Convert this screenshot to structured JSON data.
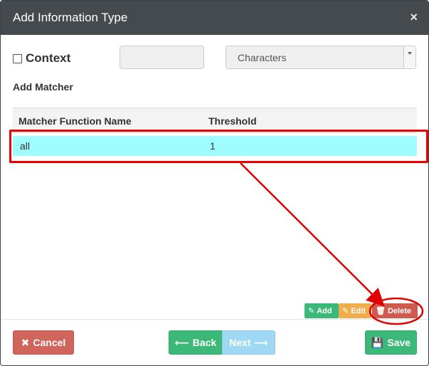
{
  "dialog": {
    "title": "Add Information Type",
    "close_glyph": "×"
  },
  "form": {
    "context_label": "Context",
    "context_input_value": "",
    "select_value": "Characters",
    "section_label": "Add Matcher"
  },
  "table": {
    "columns": [
      "Matcher Function Name",
      "Threshold"
    ],
    "rows": [
      {
        "name": "all",
        "threshold": "1"
      }
    ]
  },
  "row_actions": {
    "add_label": "Add",
    "edit_label": "Edit",
    "delete_label": "Delete"
  },
  "footer": {
    "cancel_label": "Cancel",
    "back_label": "Back",
    "next_label": "Next",
    "save_label": "Save"
  },
  "icons": {
    "pencil": "✎",
    "trash": "🗑",
    "times": "✖",
    "arrow_left": "⟵",
    "arrow_right": "⟶",
    "floppy": "💾"
  },
  "colors": {
    "header_bg": "#454a4e",
    "selected_row": "#9ffcff",
    "success": "#3cb878",
    "warning": "#f0ad4e",
    "danger": "#d05a4e",
    "annotation": "#e00000"
  }
}
